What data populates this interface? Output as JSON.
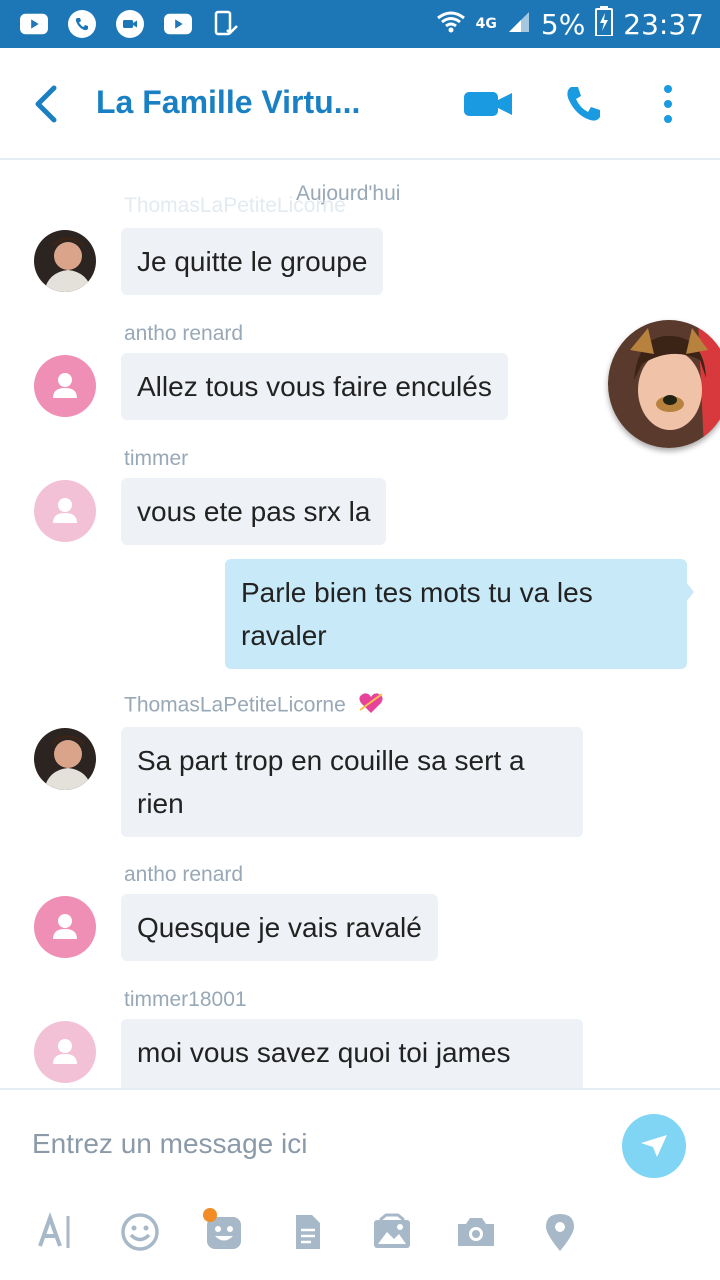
{
  "status_bar": {
    "network": "4G",
    "battery": "5%",
    "time": "23:37"
  },
  "header": {
    "title": "La Famille Virtu...",
    "accent_color": "#1a80c4"
  },
  "chat": {
    "date_separator": "Aujourd'hui",
    "faded_sender": "ThomasLaPetiteLicorne",
    "messages": [
      {
        "sender": "",
        "text": "Je quitte le groupe",
        "direction": "in"
      },
      {
        "sender": "antho renard",
        "text": "Allez tous vous faire enculés",
        "direction": "in"
      },
      {
        "sender": "timmer",
        "text": "vous ete pas srx la",
        "direction": "in"
      },
      {
        "sender": "",
        "text": "Parle bien tes mots tu va les ravaler",
        "direction": "out"
      },
      {
        "sender": "ThomasLaPetiteLicorne",
        "text": "Sa part trop en couille sa sert a rien",
        "direction": "in"
      },
      {
        "sender": "antho renard",
        "text": "Quesque je vais ravalé",
        "direction": "in"
      },
      {
        "sender": "timmer18001",
        "text": "moi vous savez quoi toi james",
        "direction": "in"
      }
    ]
  },
  "composer": {
    "placeholder": "Entrez un message ici",
    "send_color": "#80d5f5",
    "tools": [
      "text-format-icon",
      "emoji-icon",
      "mojis-icon",
      "file-icon",
      "media-icon",
      "camera-icon",
      "location-icon"
    ]
  }
}
